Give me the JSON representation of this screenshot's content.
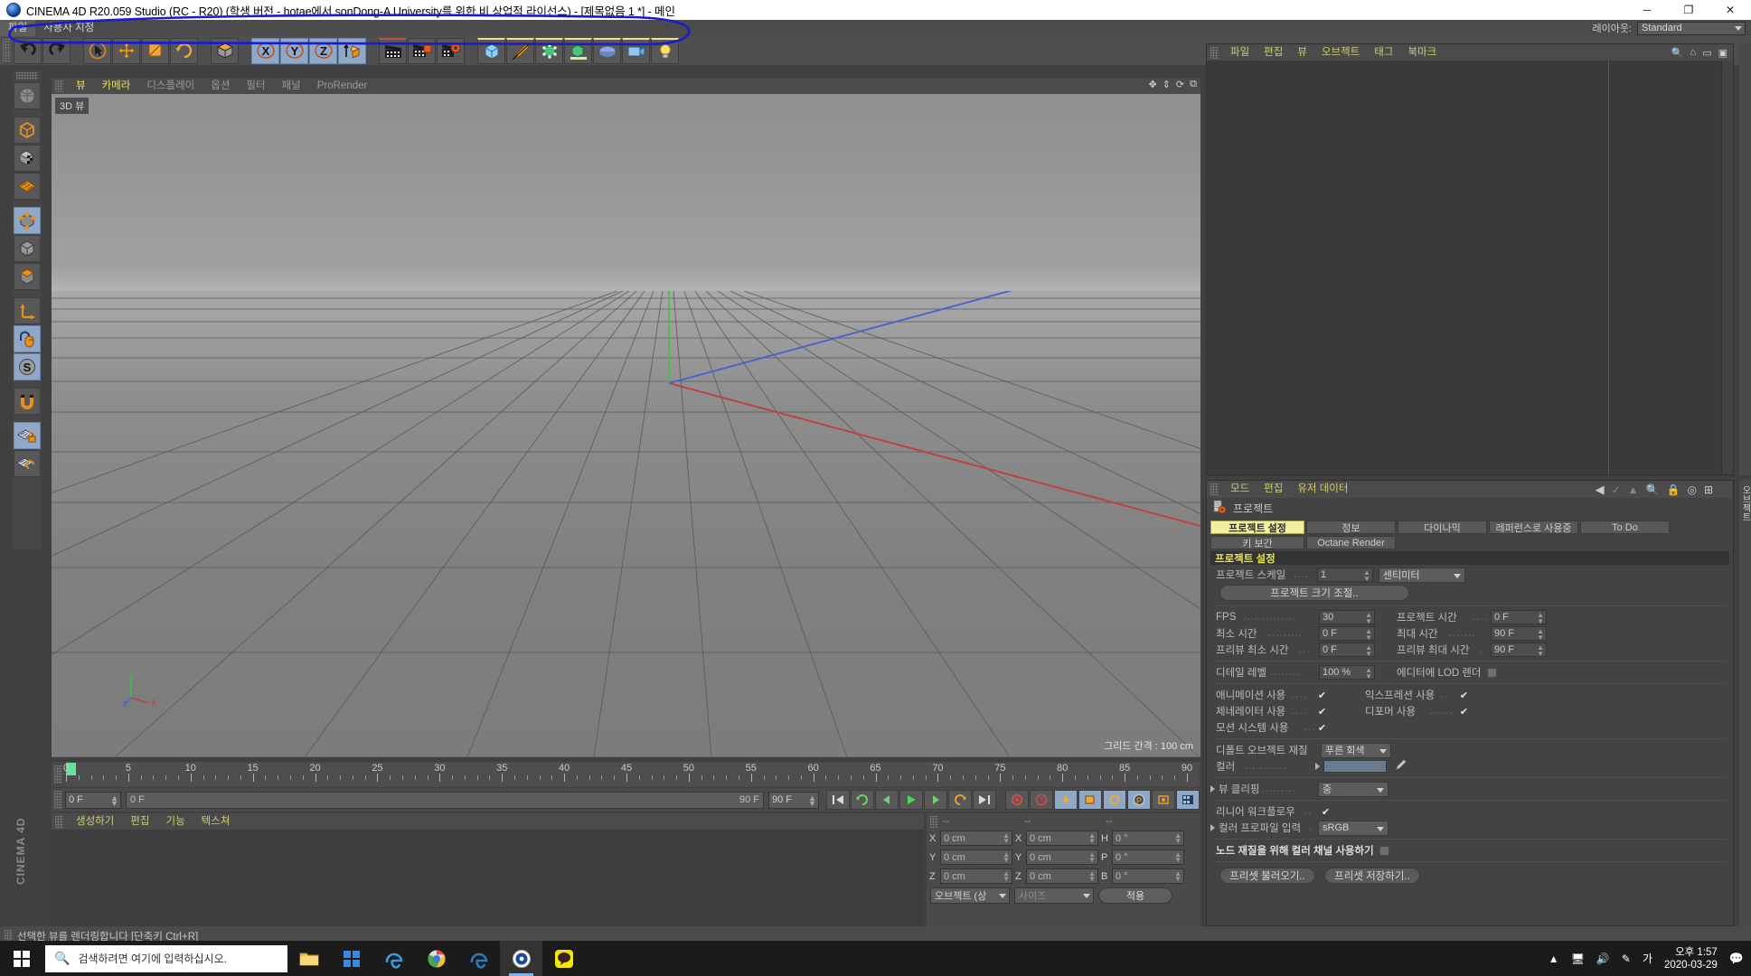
{
  "window": {
    "title": "CINEMA 4D R20.059 Studio (RC - R20) (학생 버전 - hotae에서 sonDong-A University를 위한 비 상업적 라이선스) - [제목없음 1 *] - 메인",
    "minimize": "─",
    "maximize": "❐",
    "close": "✕"
  },
  "menu": {
    "items": [
      "파일",
      "사용자 지정"
    ],
    "layout_label": "레이아웃:",
    "layout_value": "Standard"
  },
  "toolbar": {
    "groups": [
      {
        "name": "history",
        "items": [
          {
            "icon": "undo-icon",
            "label": "실행 취소"
          },
          {
            "icon": "redo-icon",
            "label": "다시 실행"
          }
        ]
      },
      {
        "name": "transform",
        "items": [
          {
            "icon": "select-live-icon",
            "label": "라이브 선택"
          },
          {
            "icon": "move-icon",
            "label": "이동"
          },
          {
            "icon": "scale-icon",
            "label": "스케일"
          },
          {
            "icon": "rotate-icon",
            "label": "회전"
          }
        ]
      },
      {
        "name": "render-mode",
        "items": [
          {
            "icon": "cube-shade-icon",
            "label": "디스플레이"
          }
        ]
      },
      {
        "name": "axis-lock",
        "items": [
          {
            "icon": "axis-x-icon",
            "label": "X"
          },
          {
            "icon": "axis-y-icon",
            "label": "Y"
          },
          {
            "icon": "axis-z-icon",
            "label": "Z"
          },
          {
            "icon": "world-axis-icon",
            "label": "월드/오브젝트 좌표계"
          }
        ]
      },
      {
        "name": "render",
        "items": [
          {
            "icon": "render-view-icon",
            "label": "뷰 렌더링"
          },
          {
            "icon": "render-picture-icon",
            "label": "픽쳐 뷰어로 렌더링"
          },
          {
            "icon": "render-settings-icon",
            "label": "렌더 설정 편집"
          }
        ]
      },
      {
        "name": "create",
        "items": [
          {
            "icon": "cube-primitive-icon",
            "label": "큐브"
          },
          {
            "icon": "pen-spline-icon",
            "label": "펜"
          },
          {
            "icon": "nurbs-icon",
            "label": "서브디비전 서페이스"
          },
          {
            "icon": "array-icon",
            "label": "배열"
          },
          {
            "icon": "scene-icon",
            "label": "씬"
          },
          {
            "icon": "camera-icon",
            "label": "카메라"
          },
          {
            "icon": "light-icon",
            "label": "라이트"
          }
        ]
      }
    ]
  },
  "left_tools": [
    {
      "icon": "viewport-layout-icon",
      "label": "뷰포트 배치",
      "selected": false
    },
    {
      "icon": "cube-wire-icon",
      "label": "오브젝트 모드",
      "selected": false
    },
    {
      "icon": "cube-texture-icon",
      "label": "텍스쳐 모드",
      "selected": false
    },
    {
      "icon": "deformer-mesh-icon",
      "label": "디포머 모드",
      "selected": false
    },
    {
      "icon": "point-mode-icon",
      "label": "포인트 모드",
      "selected": true
    },
    {
      "icon": "edge-mode-icon",
      "label": "엣지 모드",
      "selected": false
    },
    {
      "icon": "polygon-mode-icon",
      "label": "폴리곤 모드",
      "selected": false
    },
    {
      "icon": "axis-move-icon",
      "label": "축 이동",
      "selected": false
    },
    {
      "icon": "magnet-mouse-icon",
      "label": "뷰포트 잠금",
      "selected": true
    },
    {
      "icon": "soft-selection-icon",
      "label": "소프트 선택",
      "selected": true
    },
    {
      "icon": "magnet-icon",
      "label": "마그넷",
      "selected": false
    },
    {
      "icon": "workplane-lock-icon",
      "label": "워크플레인 잠금",
      "selected": true
    },
    {
      "icon": "workplane-icon",
      "label": "워크플레인",
      "selected": false
    }
  ],
  "viewport": {
    "menu": [
      "뷰",
      "카메라",
      "디스플레이",
      "옵션",
      "필터",
      "패널",
      "ProRender"
    ],
    "active_menu_index": 1,
    "badge": "3D 뷰",
    "grid_info": "그리드 간격 : 100 cm",
    "axis_labels": {
      "x": "X",
      "y": "Y",
      "z": "Z"
    },
    "colors": {
      "x_axis": "#d44040",
      "y_axis": "#3fc23f",
      "z_axis": "#4d63d4"
    }
  },
  "timeline": {
    "ticks": [
      0,
      5,
      10,
      15,
      20,
      25,
      30,
      35,
      40,
      45,
      50,
      55,
      60,
      65,
      70,
      75,
      80,
      85,
      90
    ],
    "current_frame": "0 F",
    "playhead": 0,
    "range_start": "0 F",
    "range_end": "90 F",
    "field_left": "0 F",
    "field_right": "90 F"
  },
  "transport": {
    "buttons": [
      {
        "icon": "go-to-start-icon",
        "label": "시작으로"
      },
      {
        "icon": "loop-icon",
        "label": "반복 재생"
      },
      {
        "icon": "step-back-icon",
        "label": "이전 프레임"
      },
      {
        "icon": "play-icon",
        "label": "재생"
      },
      {
        "icon": "step-forward-icon",
        "label": "다음 프레임"
      },
      {
        "icon": "loop-back-icon",
        "label": "뒤로 재생"
      },
      {
        "icon": "go-to-end-icon",
        "label": "끝으로"
      },
      {
        "icon": "record-icon",
        "label": "액티브 오브젝트 기록"
      },
      {
        "icon": "autokey-icon",
        "label": "오토키"
      },
      {
        "icon": "key-position-icon",
        "label": "위치 기록"
      },
      {
        "icon": "key-scale-icon",
        "label": "스케일 기록"
      },
      {
        "icon": "key-rotation-icon",
        "label": "회전 기록"
      },
      {
        "icon": "key-param-icon",
        "label": "파라미터 기록"
      },
      {
        "icon": "key-pla-icon",
        "label": "PLA 기록"
      },
      {
        "icon": "dope-sheet-icon",
        "label": "키프레임 선택"
      }
    ]
  },
  "material_manager": {
    "menu": [
      "생성하기",
      "편집",
      "기능",
      "텍스쳐"
    ]
  },
  "coordinates": {
    "headers": [
      "--",
      "--",
      "--"
    ],
    "rows": [
      {
        "axis": "X",
        "position": "0 cm",
        "axis2": "X",
        "size": "0 cm",
        "rot_label": "H",
        "rot": "0 °"
      },
      {
        "axis": "Y",
        "position": "0 cm",
        "axis2": "Y",
        "size": "0 cm",
        "rot_label": "P",
        "rot": "0 °"
      },
      {
        "axis": "Z",
        "position": "0 cm",
        "axis2": "Z",
        "size": "0 cm",
        "rot_label": "B",
        "rot": "0 °"
      }
    ],
    "mode_left": "오브젝트 (상",
    "mode_right": "사이즈",
    "apply": "적용"
  },
  "object_manager": {
    "menu": [
      "파일",
      "편집",
      "뷰",
      "오브젝트",
      "태그",
      "북마크"
    ],
    "icons": [
      "search-icon",
      "home-icon",
      "minimize-icon",
      "maximize-icon"
    ],
    "items": []
  },
  "attribute_manager": {
    "menu": [
      "모드",
      "편집",
      "유저 데이터"
    ],
    "icons": [
      "arrow-left-icon",
      "arrow-check-icon",
      "arrow-up-icon",
      "search-icon",
      "lock-icon",
      "target-icon",
      "grid-icon"
    ],
    "object_title": "프로젝트",
    "object_icon": "project-settings-icon",
    "tabs_row1": [
      "프로젝트 설정",
      "정보",
      "다이나믹",
      "레퍼런스로 사용중",
      "To Do"
    ],
    "tabs_row2": [
      "키 보간",
      "Octane Render"
    ],
    "active_tab": "프로젝트 설정",
    "section_title": "프로젝트 설정",
    "fields": {
      "project_scale_label": "프로젝트 스케일",
      "project_scale_value": "1",
      "project_scale_unit": "센티미터",
      "project_scale_button": "프로젝트 크기 조절..",
      "fps_label": "FPS",
      "fps_value": "30",
      "project_time_label": "프로젝트 시간",
      "project_time_value": "0 F",
      "min_time_label": "최소 시간",
      "min_time_value": "0 F",
      "max_time_label": "최대 시간",
      "max_time_value": "90 F",
      "preview_min_label": "프리뷰 최소 시간",
      "preview_min_value": "0 F",
      "preview_max_label": "프리뷰 최대 시간",
      "preview_max_value": "90 F",
      "detail_label": "디테일 레벨",
      "detail_value": "100 %",
      "lod_label": "에디터에 LOD 렌더",
      "lod_checked": false,
      "anim_label": "애니메이션 사용",
      "anim_checked": true,
      "expr_label": "익스프레션 사용",
      "expr_checked": true,
      "gen_label": "제네레이터 사용",
      "gen_checked": true,
      "def_label": "디포머 사용",
      "def_checked": true,
      "motion_label": "모션 시스템 사용",
      "motion_checked": true,
      "default_mat_label": "디폴트 오브젝트 재질",
      "default_mat_value": "푸른 회색",
      "color_label": "컬러",
      "color_swatch": "#6a7b8c",
      "view_clip_label": "뷰 클리핑",
      "view_clip_value": "중",
      "linear_label": "리니어 워크플로우",
      "linear_checked": true,
      "profile_label": "컬러 프로파일 입력",
      "profile_value": "sRGB",
      "node_label": "노드 재질을 위해 컬러 채널 사용하기",
      "node_checked": false,
      "preset_load": "프리셋 불러오기..",
      "preset_save": "프리셋 저장하기.."
    },
    "vertical_tab": "오브젝트"
  },
  "status_bar": {
    "text": "선택한 뷰를 렌더링합니다 [단축키 Ctrl+R]"
  },
  "watermark": "CINEMA 4D",
  "taskbar": {
    "search_placeholder": "검색하려면 여기에 입력하십시오.",
    "apps": [
      {
        "icon": "file-explorer-icon",
        "label": "파일 탐색기",
        "active": false
      },
      {
        "icon": "microsoft-store-icon",
        "label": "Microsoft Store",
        "active": false
      },
      {
        "icon": "edge-legacy-icon",
        "label": "Microsoft Edge",
        "active": false
      },
      {
        "icon": "chrome-icon",
        "label": "Google Chrome",
        "active": false
      },
      {
        "icon": "edge-icon",
        "label": "Edge",
        "active": false
      },
      {
        "icon": "c4d-icon",
        "label": "CINEMA 4D",
        "active": true
      },
      {
        "icon": "kakao-icon",
        "label": "KakaoTalk",
        "active": false
      }
    ],
    "tray": [
      "chevron-up-icon",
      "monitor-icon",
      "volume-icon",
      "pen-icon",
      "ime-icon"
    ],
    "ime": "가",
    "clock_time": "오후 1:57",
    "clock_date": "2020-03-29"
  }
}
